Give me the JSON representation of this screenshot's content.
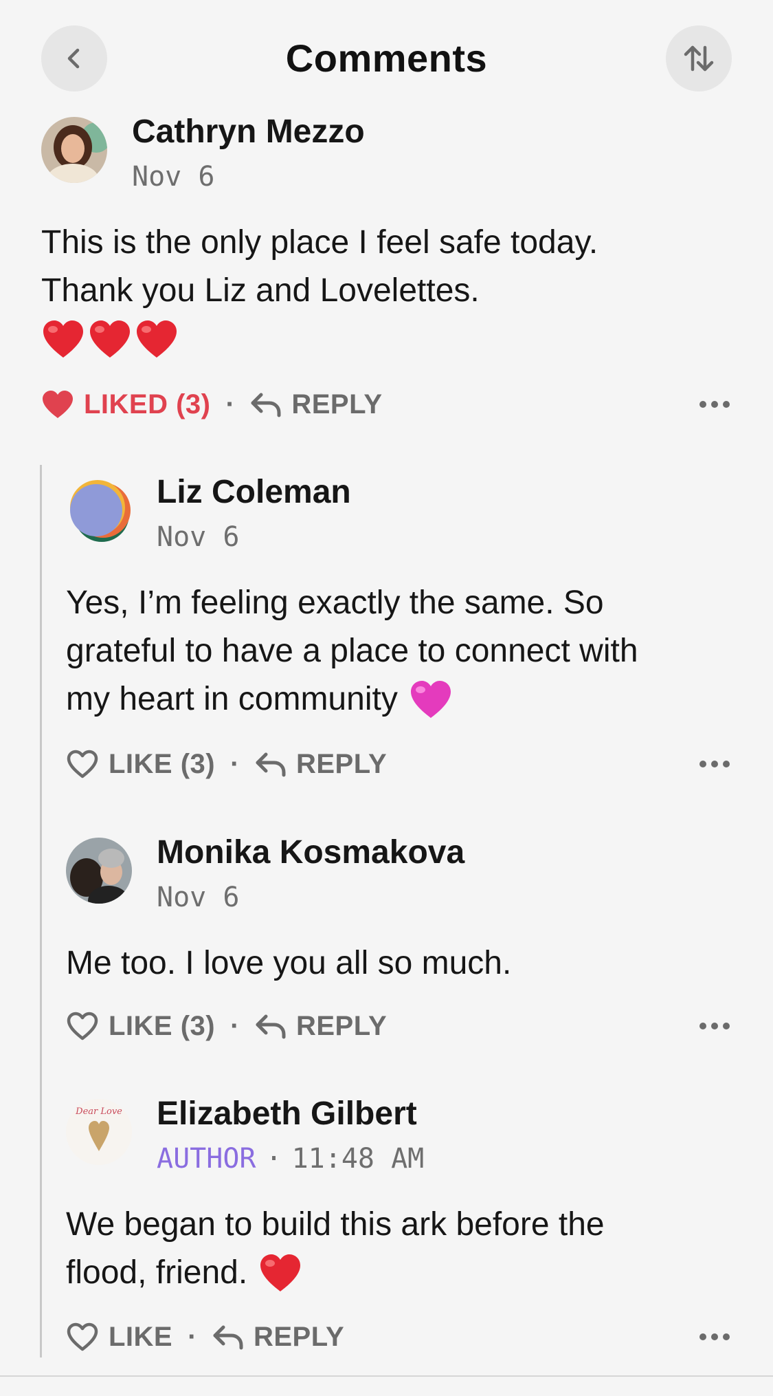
{
  "header": {
    "title": "Comments",
    "back_icon": "chevron-left-icon",
    "sort_icon": "sort-arrows-icon"
  },
  "colors": {
    "background": "#f5f5f5",
    "liked_red": "#e0424f",
    "author_purple": "#8a6de0",
    "muted_gray": "#6b6b6b"
  },
  "comments": [
    {
      "author": "Cathryn Mezzo",
      "date": "Nov 6",
      "body_lines": [
        "This is the only place I feel safe today.",
        "Thank you Liz and Lovelettes."
      ],
      "emojis": [
        "red-heart",
        "red-heart",
        "red-heart"
      ],
      "like_label": "LIKED (3)",
      "liked": true,
      "reply_label": "REPLY"
    },
    {
      "author": "Liz Coleman",
      "date": "Nov 6",
      "body_lines": [
        "Yes, I’m feeling exactly the same. So",
        "grateful to have a place to connect with",
        "my heart in community"
      ],
      "emojis": [
        "pink-heart"
      ],
      "like_label": "LIKE (3)",
      "liked": false,
      "reply_label": "REPLY"
    },
    {
      "author": "Monika Kosmakova",
      "date": "Nov 6",
      "body_lines": [
        "Me too. I love you all so much."
      ],
      "like_label": "LIKE (3)",
      "liked": false,
      "reply_label": "REPLY"
    },
    {
      "author": "Elizabeth Gilbert",
      "tag": "AUTHOR",
      "date": "11:48 AM",
      "avatar_text": "Dear Love",
      "body_lines": [
        "We began to build this ark before the",
        "flood, friend."
      ],
      "emojis": [
        "red-heart"
      ],
      "like_label": "LIKE",
      "liked": false,
      "reply_label": "REPLY"
    }
  ]
}
